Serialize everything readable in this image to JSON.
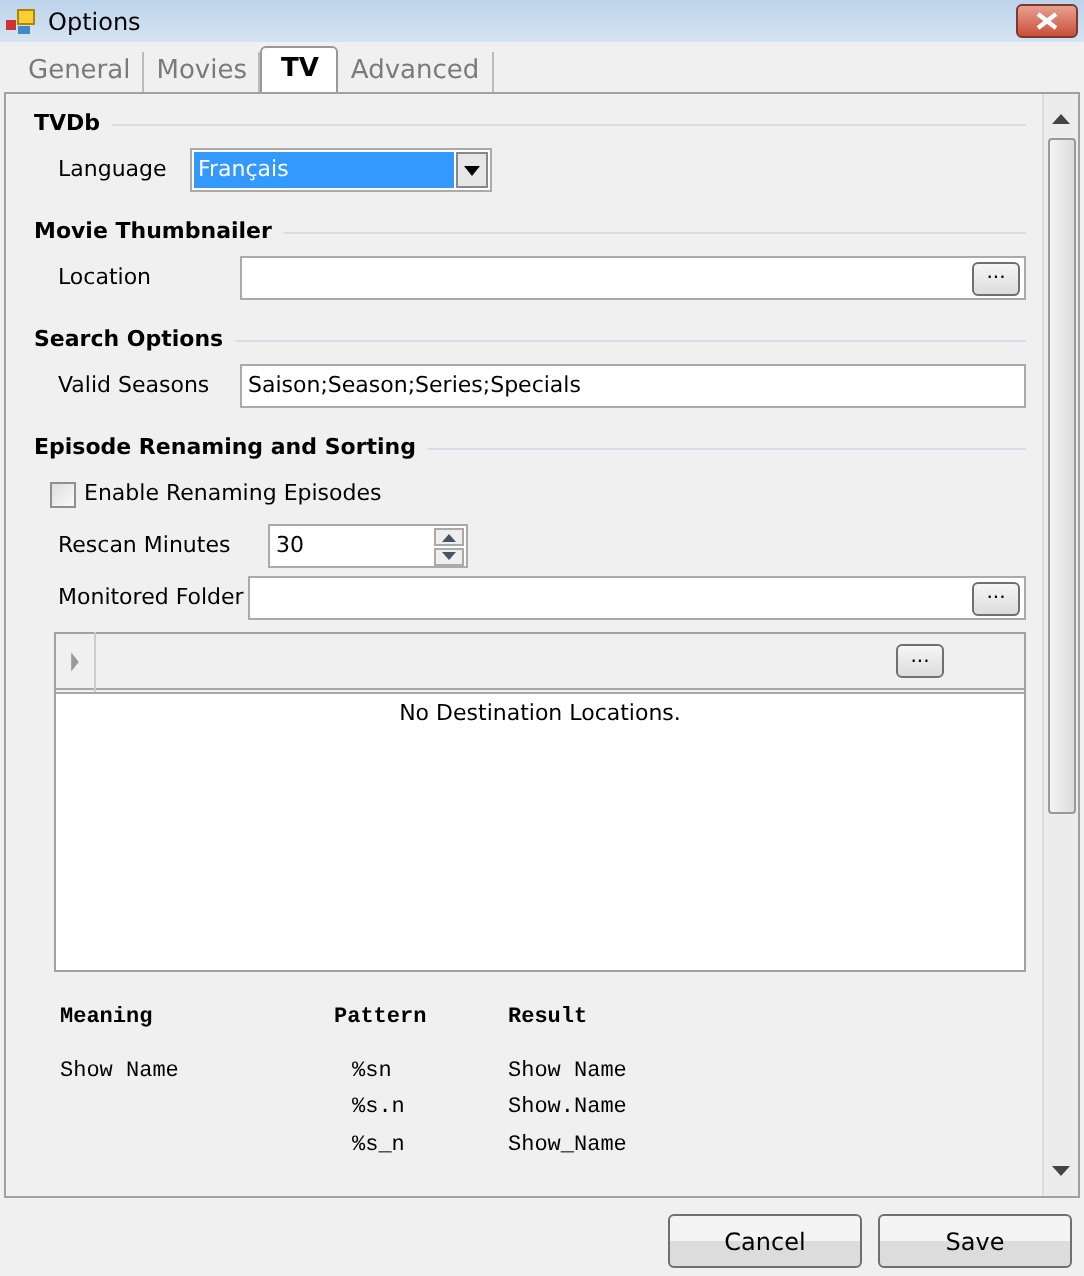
{
  "window": {
    "title": "Options"
  },
  "tabs": [
    {
      "label": "General",
      "selected": false
    },
    {
      "label": "Movies",
      "selected": false
    },
    {
      "label": "TV",
      "selected": true
    },
    {
      "label": "Advanced",
      "selected": false
    }
  ],
  "sections": [
    {
      "title": "TVDb",
      "fields": [
        {
          "kind": "select",
          "label": "Language",
          "value": "Français"
        }
      ]
    },
    {
      "title": "Movie Thumbnailer",
      "fields": [
        {
          "kind": "browse",
          "label": "Location",
          "button": "..."
        }
      ]
    },
    {
      "title": "Search Options",
      "fields": [
        {
          "kind": "text",
          "label": "Valid Seasons",
          "value": "Saison;Season;Series;Specials"
        }
      ]
    },
    {
      "title": "Episode Renaming and Sorting",
      "fields": [
        {
          "kind": "checkbox",
          "label": "Enable Renaming Episodes",
          "checked": false
        },
        {
          "kind": "spin",
          "label": "Rescan Minutes",
          "value": "30"
        },
        {
          "kind": "browse",
          "label": "Monitored Folder",
          "button": "..."
        }
      ]
    }
  ],
  "destinations": {
    "button": "...",
    "empty_text": "No Destination Locations."
  },
  "pattern_table": {
    "columns": [
      "Meaning",
      "Pattern",
      "Result"
    ],
    "rows": [
      {
        "meaning": "Show Name",
        "patterns": [
          {
            "pattern": "%sn",
            "result": "Show Name"
          },
          {
            "pattern": "%s.n",
            "result": "Show.Name"
          },
          {
            "pattern": "%s_n",
            "result": "Show_Name"
          }
        ]
      }
    ]
  },
  "buttons": [
    "Cancel",
    "Save"
  ]
}
